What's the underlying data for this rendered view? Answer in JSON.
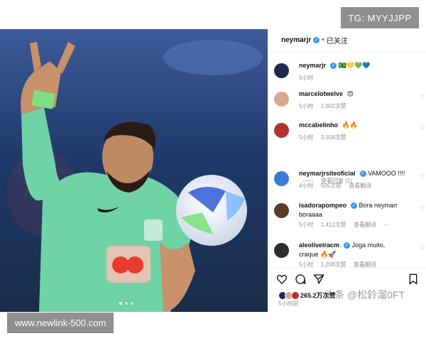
{
  "watermarks": {
    "top_right": "TG: MYYJJPP",
    "bottom_left": "www.newlink-500.com",
    "author": "头条 @松鈴溜0FT"
  },
  "post": {
    "username": "neymarjr",
    "follow_status": "已关注",
    "separator": "•"
  },
  "comments": [
    {
      "user": "neymarjr",
      "text": "🇧🇷💛💚💙",
      "time": "5小时",
      "likes": "",
      "reply": "",
      "avatar_color": "#1c2a52"
    },
    {
      "user": "marcelotwelve",
      "text": "😍",
      "time": "5小时",
      "likes": "2,902次赞",
      "reply": "",
      "avatar_color": "#d7a98c"
    },
    {
      "user": "mccabelinho",
      "text": "🔥🔥",
      "time": "5小时",
      "likes": "3,558次赞",
      "reply": "",
      "avatar_color": "#b5322c"
    },
    {
      "user": "neymarjrsiteoficial",
      "text": "VAMOOO !!!!",
      "time": "4小时",
      "likes": "505次赞",
      "reply": "查看翻译",
      "avatar_color": "#3a7bd5"
    },
    {
      "user": "isadorapompeo",
      "text": "Bora neymarr boraaaa",
      "time": "5小时",
      "likes": "1,412次赞",
      "reply": "查看翻译",
      "more": "···",
      "avatar_color": "#5a3a2a"
    },
    {
      "user": "aleoliveiracm",
      "text": "Joga muito, craque 🔥🚀",
      "time": "5小时",
      "likes": "1,208次赞",
      "reply": "查看翻译",
      "avatar_color": "#2d2d2d"
    }
  ],
  "view_replies": "查看回复 (1)",
  "actions": {
    "like_icon": "heart-icon",
    "comment_icon": "comment-icon",
    "share_icon": "send-icon",
    "save_icon": "bookmark-icon"
  },
  "likes_count": "265.2万次赞",
  "posted_ago": "5小时前",
  "colors": {
    "verified": "#3897f0",
    "jersey": "#6fd3a6",
    "muted_text": "#8e8e8e"
  }
}
